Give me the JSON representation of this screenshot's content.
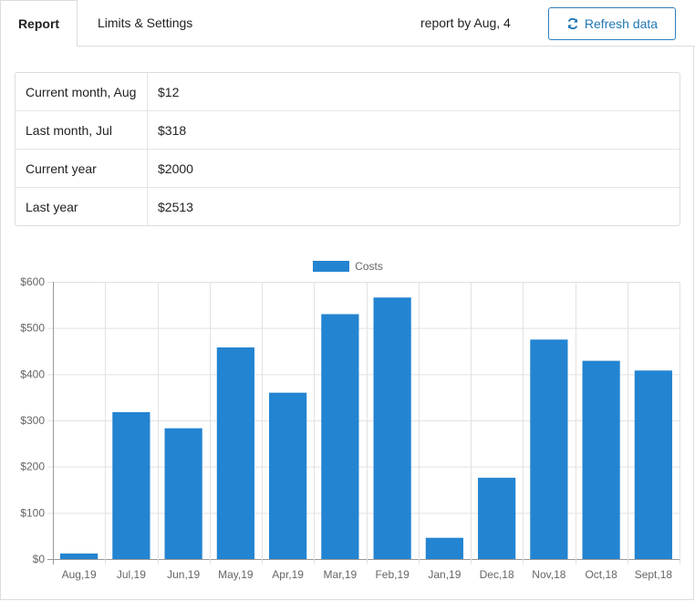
{
  "tabs": {
    "report": "Report",
    "limits": "Limits & Settings"
  },
  "header": {
    "report_date": "report by Aug, 4",
    "refresh_label": "Refresh data"
  },
  "summary": [
    {
      "label": "Current month, Aug",
      "value": "$12"
    },
    {
      "label": "Last month, Jul",
      "value": "$318"
    },
    {
      "label": "Current year",
      "value": "$2000"
    },
    {
      "label": "Last year",
      "value": "$2513"
    }
  ],
  "colors": {
    "accent": "#1f77b4",
    "bar": "#2384d1"
  },
  "chart_data": {
    "type": "bar",
    "categories": [
      "Aug,19",
      "Jul,19",
      "Jun,19",
      "May,19",
      "Apr,19",
      "Mar,19",
      "Feb,19",
      "Jan,19",
      "Dec,18",
      "Nov,18",
      "Oct,18",
      "Sept,18"
    ],
    "series": [
      {
        "name": "Costs",
        "values": [
          12,
          318,
          283,
          458,
          360,
          530,
          566,
          46,
          176,
          475,
          429,
          408
        ]
      }
    ],
    "y_ticks": [
      "$0",
      "$100",
      "$200",
      "$300",
      "$400",
      "$500",
      "$600"
    ],
    "ylim": [
      0,
      600
    ],
    "grid": true,
    "legend": "top"
  }
}
